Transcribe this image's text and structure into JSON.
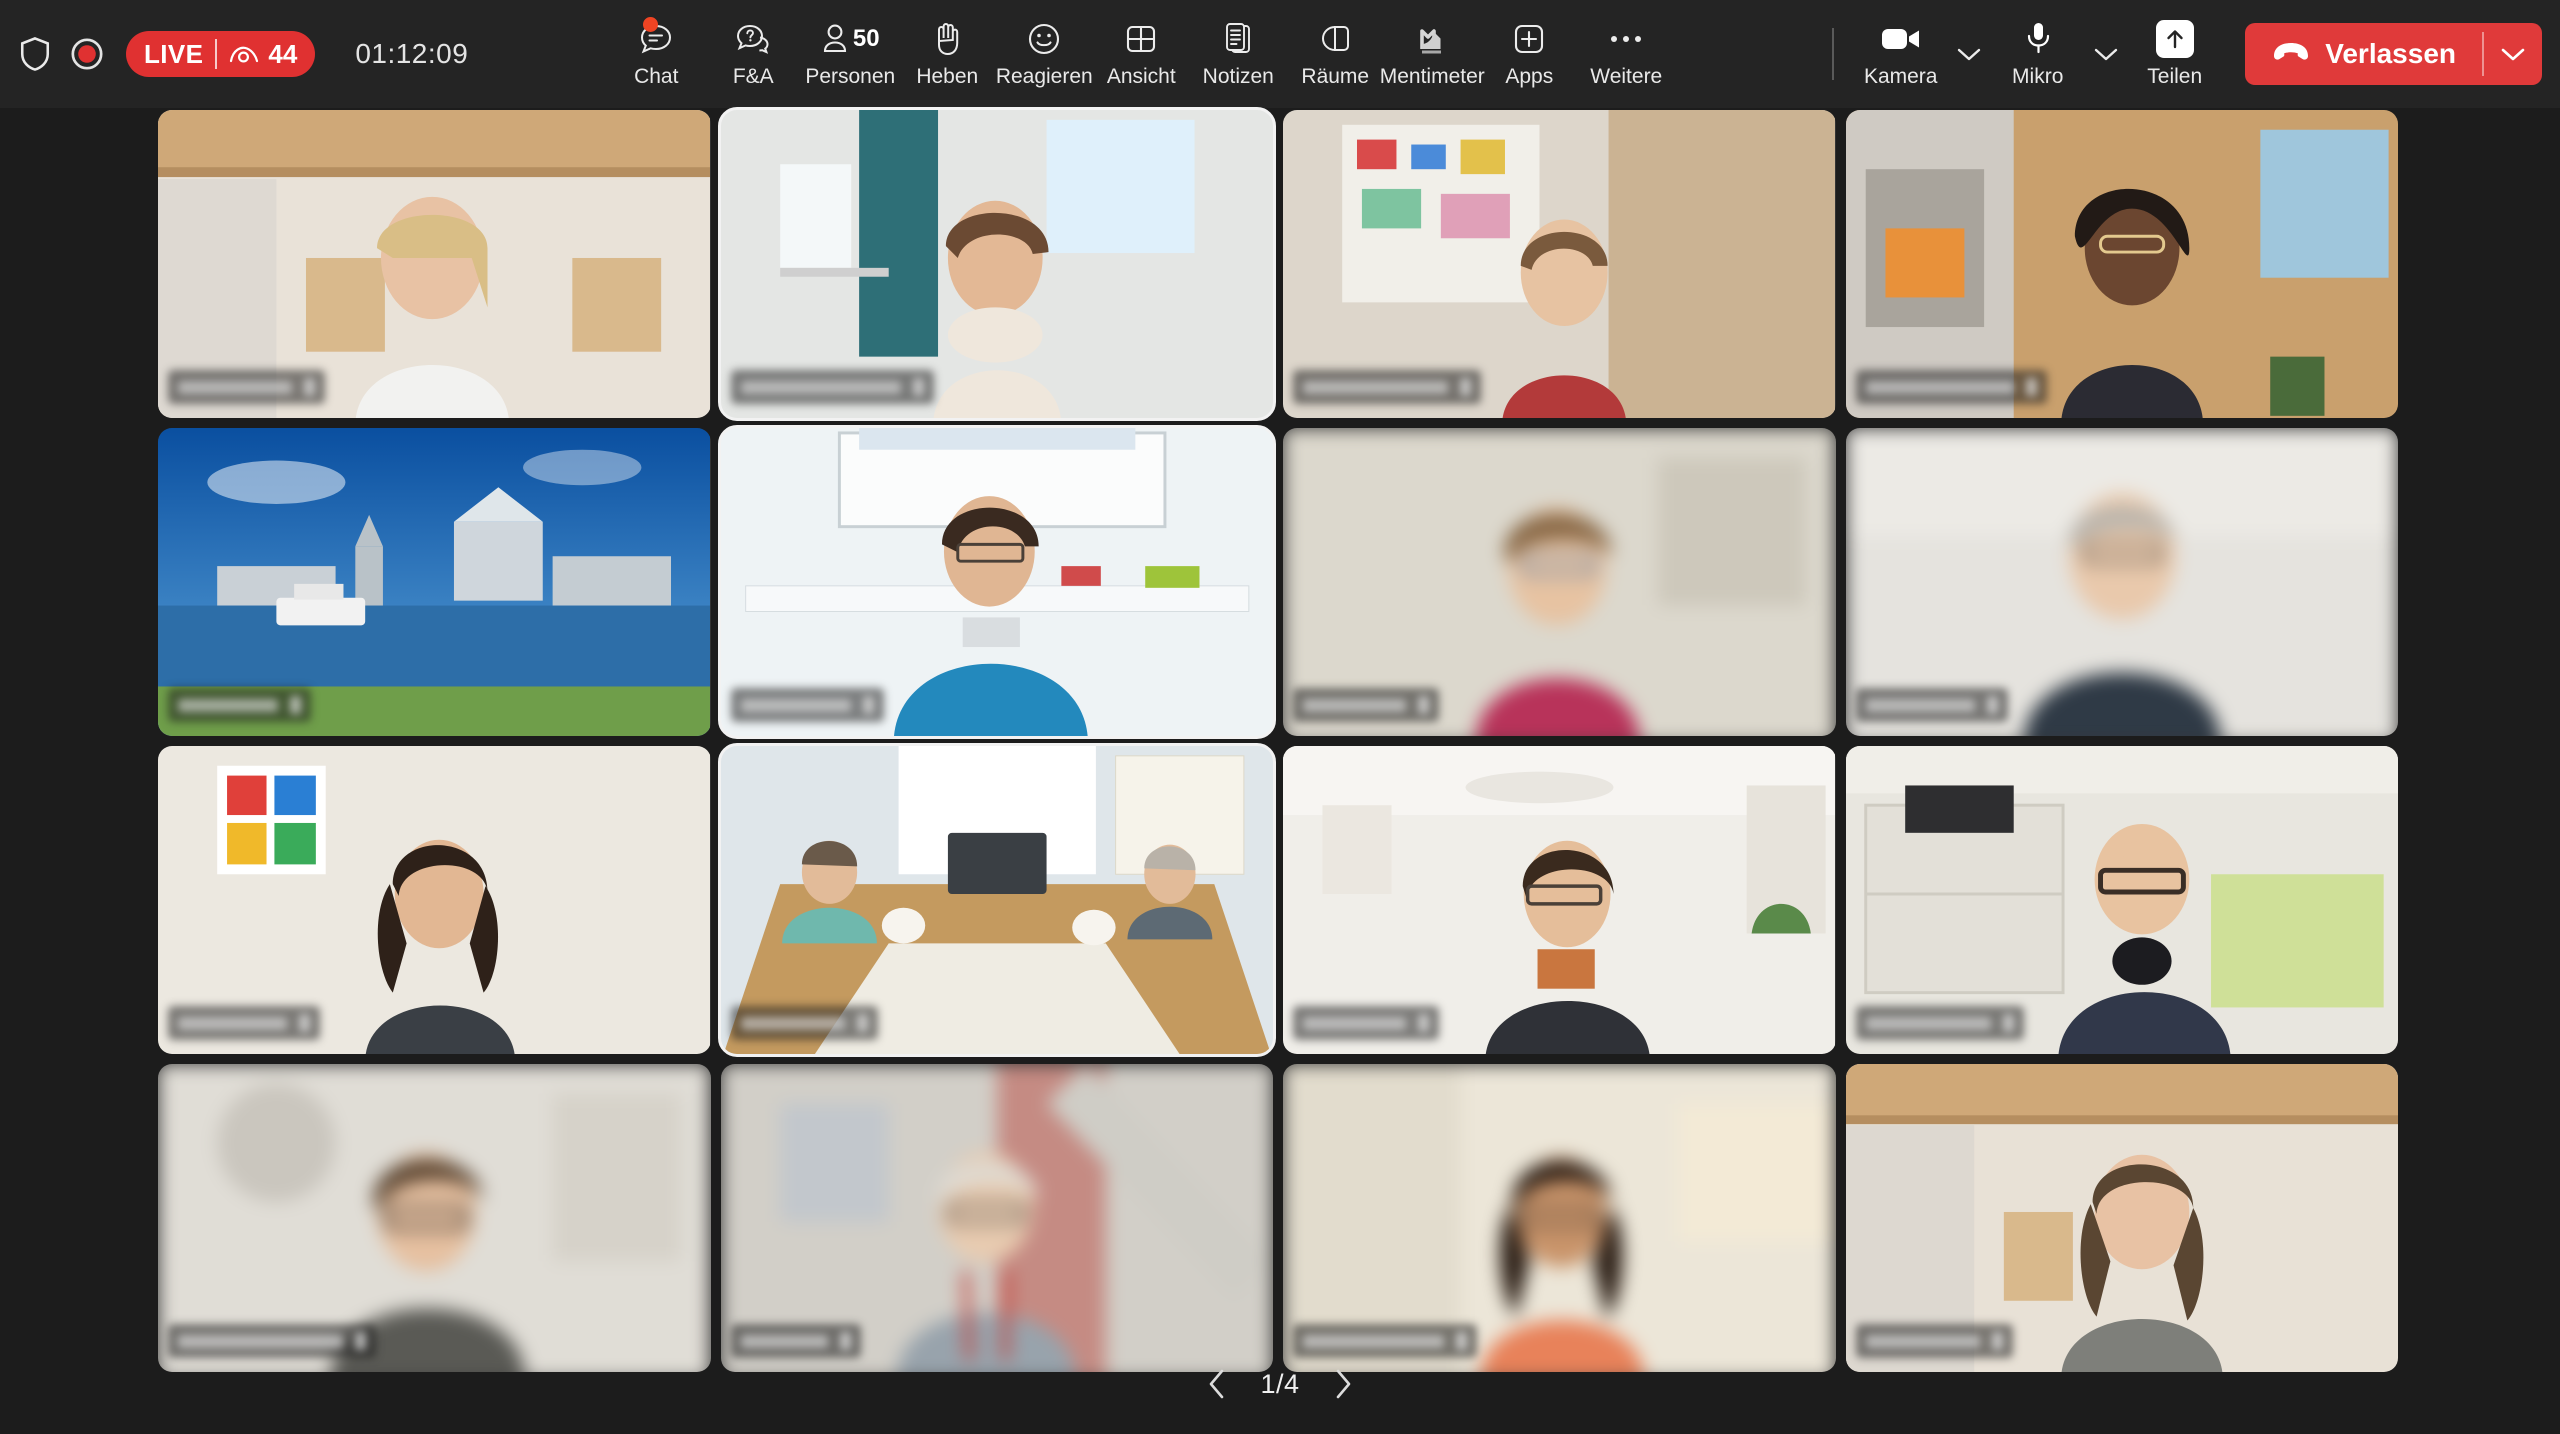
{
  "app": {
    "background": "#1c1c1c",
    "toolbar_bg": "#242424",
    "accent_red": "#e03131",
    "leave_red": "#e03a3a",
    "badge_orange": "#ef4423"
  },
  "toolbar": {
    "left": {
      "shield_icon": "shield-icon",
      "record_icon": "record-icon",
      "live_label": "LIVE",
      "viewers_icon": "eye-icon",
      "viewers_count": "44",
      "timer": "01:12:09"
    },
    "center_items": [
      {
        "label": "Chat",
        "icon": "chat-icon",
        "badge": true
      },
      {
        "label": "F&A",
        "icon": "question-chat-icon",
        "badge": false
      },
      {
        "label": "Personen",
        "icon": "person-icon",
        "count": "50",
        "badge": false
      },
      {
        "label": "Heben",
        "icon": "raise-hand-icon",
        "badge": false
      },
      {
        "label": "Reagieren",
        "icon": "smiley-icon",
        "badge": false
      },
      {
        "label": "Ansicht",
        "icon": "grid-view-icon",
        "badge": false
      },
      {
        "label": "Notizen",
        "icon": "notes-icon",
        "badge": false
      },
      {
        "label": "Räume",
        "icon": "breakout-rooms-icon",
        "badge": false
      },
      {
        "label": "Mentimeter",
        "icon": "mentimeter-icon",
        "badge": false
      },
      {
        "label": "Apps",
        "icon": "plus-square-icon",
        "badge": false
      },
      {
        "label": "Weitere",
        "icon": "ellipsis-icon",
        "badge": false
      }
    ],
    "right": {
      "camera_label": "Kamera",
      "camera_icon": "camera-icon",
      "camera_chevron": "chevron-down-icon",
      "mic_label": "Mikro",
      "mic_icon": "microphone-icon",
      "mic_chevron": "chevron-down-icon",
      "share_label": "Teilen",
      "share_icon": "share-up-arrow-icon",
      "leave_label": "Verlassen",
      "leave_icon": "hangup-phone-icon",
      "leave_chevron": "chevron-down-icon"
    }
  },
  "grid": {
    "columns": 4,
    "rows": 4,
    "tiles": [
      {
        "id": 1,
        "highlighted": false,
        "name_redacted": true,
        "name_width": 168
      },
      {
        "id": 2,
        "highlighted": true,
        "name_redacted": true,
        "name_width": 236
      },
      {
        "id": 3,
        "highlighted": false,
        "name_redacted": true,
        "name_width": 213
      },
      {
        "id": 4,
        "highlighted": false,
        "name_redacted": true,
        "name_width": 218
      },
      {
        "id": 5,
        "highlighted": false,
        "name_redacted": true,
        "name_width": 147
      },
      {
        "id": 6,
        "highlighted": true,
        "name_redacted": true,
        "name_width": 162
      },
      {
        "id": 7,
        "highlighted": false,
        "name_redacted": true,
        "name_width": 152
      },
      {
        "id": 8,
        "highlighted": false,
        "name_redacted": true,
        "name_width": 161
      },
      {
        "id": 9,
        "highlighted": false,
        "name_redacted": true,
        "name_width": 160
      },
      {
        "id": 10,
        "highlighted": true,
        "name_redacted": true,
        "name_width": 154
      },
      {
        "id": 11,
        "highlighted": false,
        "name_redacted": true,
        "name_width": 152
      },
      {
        "id": 12,
        "highlighted": false,
        "name_redacted": true,
        "name_width": 185
      },
      {
        "id": 13,
        "highlighted": false,
        "name_redacted": true,
        "name_width": 243
      },
      {
        "id": 14,
        "highlighted": false,
        "name_redacted": true,
        "name_width": 128
      },
      {
        "id": 15,
        "highlighted": false,
        "name_redacted": true,
        "name_width": 208
      },
      {
        "id": 16,
        "highlighted": false,
        "name_redacted": true,
        "name_width": 168
      }
    ]
  },
  "pager": {
    "prev_icon": "chevron-left-icon",
    "label": "1/4",
    "next_icon": "chevron-right-icon"
  }
}
